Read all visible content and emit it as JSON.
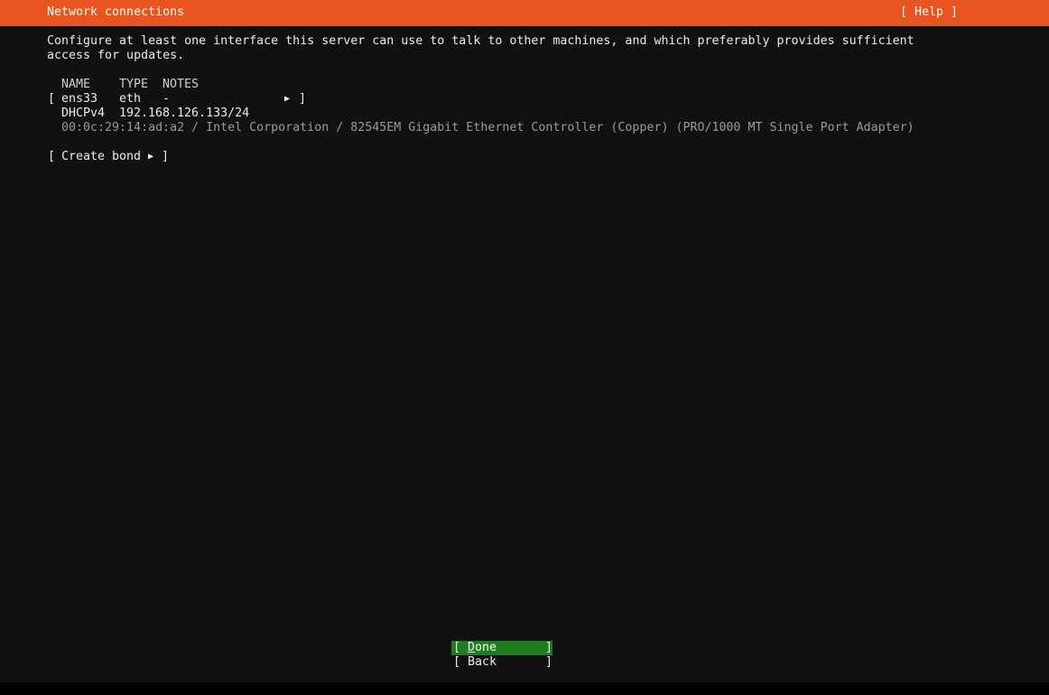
{
  "header": {
    "title": "Network connections",
    "help_label": "[ Help ]"
  },
  "intro": {
    "line1": "Configure at least one interface this server can use to talk to other machines, and which preferably provides sufficient",
    "line2": "access for updates."
  },
  "table": {
    "columns": {
      "name": "NAME",
      "type": "TYPE",
      "notes": "NOTES"
    },
    "interface": {
      "open_bracket": "[",
      "name": "ens33",
      "type": "eth",
      "notes": "-",
      "close_bracket": "]",
      "address_method": "DHCPv4",
      "address": "192.168.126.133/24",
      "hardware": "00:0c:29:14:ad:a2 / Intel Corporation / 82545EM Gigabit Ethernet Controller (Copper) (PRO/1000 MT Single Port Adapter)"
    }
  },
  "create_bond": {
    "open_bracket": "[",
    "label": "Create bond",
    "close_bracket": "]"
  },
  "buttons": {
    "done_open": "[",
    "done_hotkey": "D",
    "done_rest": "one",
    "done_close": "]",
    "back_open": "[",
    "back_label": "Back",
    "back_close": "]"
  },
  "icons": {
    "arrow": "right-triangle-icon"
  },
  "colors": {
    "header_bg": "#e95420",
    "background": "#111111",
    "done_bg": "#1e7e1e"
  }
}
